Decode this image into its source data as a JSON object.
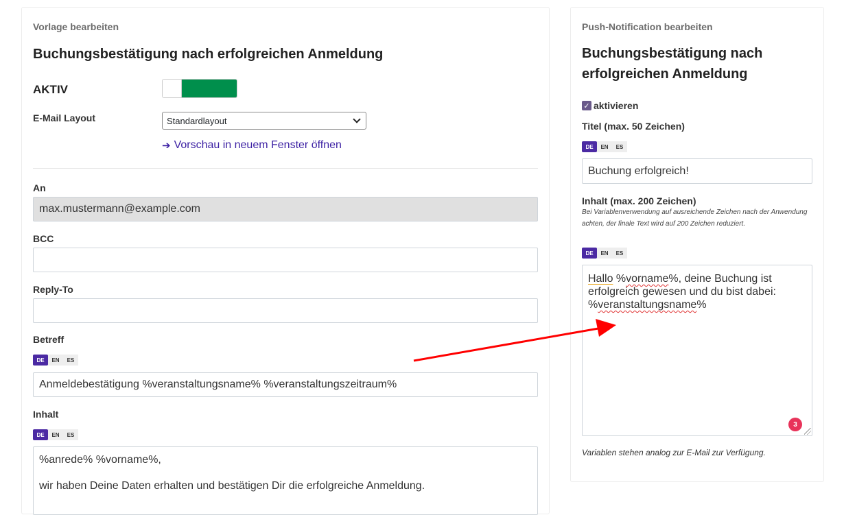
{
  "left": {
    "section_title": "Vorlage bearbeiten",
    "template_title": "Buchungsbestätigung nach erfolgreichen Anmeldung",
    "active_label": "AKTIV",
    "active_on": true,
    "layout_label": "E-Mail Layout",
    "layout_value": "Standardlayout",
    "preview_link": "Vorschau in neuem Fenster öffnen",
    "to_label": "An",
    "to_value": "max.mustermann@example.com",
    "bcc_label": "BCC",
    "bcc_value": "",
    "replyto_label": "Reply-To",
    "replyto_value": "",
    "subject_label": "Betreff",
    "subject_langs": [
      "DE",
      "EN",
      "ES"
    ],
    "subject_value": "Anmeldebestätigung %veranstaltungsname% %veranstaltungszeitraum%",
    "content_label": "Inhalt",
    "content_langs": [
      "DE",
      "EN",
      "ES"
    ],
    "content_line1": "%anrede% %vorname%,",
    "content_line2": "wir haben Deine Daten erhalten und bestätigen Dir die erfolgreiche Anmeldung."
  },
  "right": {
    "section_title": "Push-Notification bearbeiten",
    "title_line1": "Buchungsbestätigung nach",
    "title_line2": "erfolgreichen Anmeldung",
    "activate_label": "aktivieren",
    "activate_checked": true,
    "title_label": "Titel (max. 50 Zeichen)",
    "title_langs": [
      "DE",
      "EN",
      "ES"
    ],
    "title_value": "Buchung erfolgreich!",
    "content_label": "Inhalt (max. 200 Zeichen)",
    "content_hint": "Bei Variablenverwendung auf ausreichende Zeichen nach der Anwendung achten, der finale Text wird auf 200 Zeichen reduziert.",
    "content_langs": [
      "DE",
      "EN",
      "ES"
    ],
    "content_parts": {
      "p1": "Hallo",
      "p2": " %",
      "p3": "vorname",
      "p4": "%, deine Buchung ist erfolgreich gewesen und du bist dabei: %",
      "p5": "veranstaltungsname",
      "p6": "%"
    },
    "badge_count": "3",
    "footnote": "Variablen stehen analog zur E-Mail zur Verfügung."
  },
  "colors": {
    "accent": "#4b2aa3",
    "toggle_on": "#008f4c",
    "link": "#3b1fa3",
    "badge": "#e8335a",
    "annotation_arrow": "#ff0000"
  },
  "icons": {
    "preview_link_icon": "arrow-right-icon",
    "checkbox_icon": "check-icon"
  }
}
